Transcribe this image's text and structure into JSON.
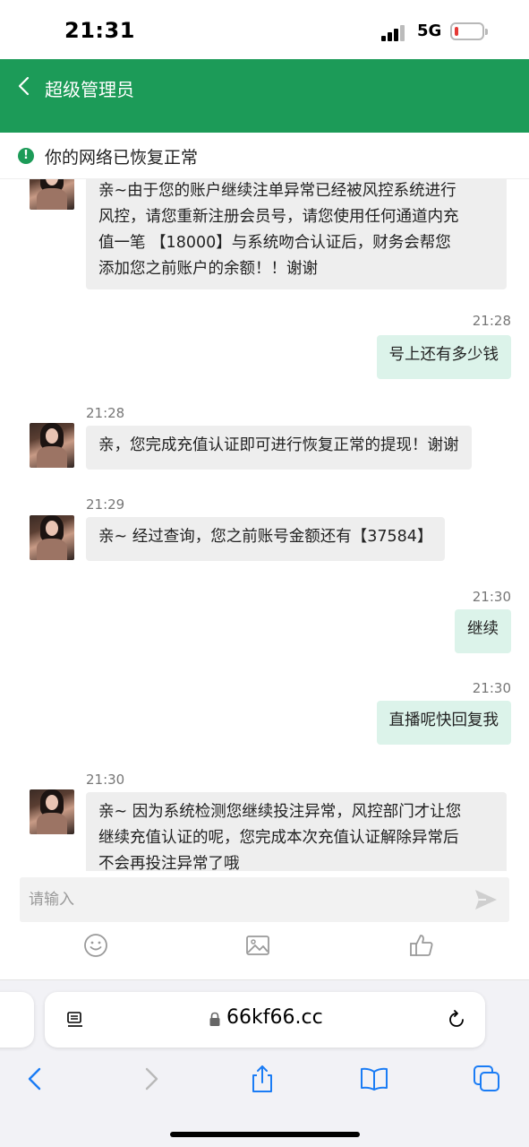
{
  "status_bar": {
    "time": "21:31",
    "network": "5G"
  },
  "header": {
    "title": "超级管理员"
  },
  "network_notice": {
    "text": "你的网络已恢复正常"
  },
  "messages": [
    {
      "dir": "in",
      "time": "",
      "lines": [
        "亲~由于您的账户继续注单异常已经被风控系统进行",
        "风控，请您重新注册会员号，请您使用任何通道内充",
        "值一笔 【18000】与系统吻合认证后，财务会帮您",
        "添加您之前账户的余额！！谢谢"
      ]
    },
    {
      "dir": "out",
      "time": "21:28",
      "lines": [
        "号上还有多少钱"
      ]
    },
    {
      "dir": "in",
      "time": "21:28",
      "lines": [
        "亲，您完成充值认证即可进行恢复正常的提现！谢谢"
      ]
    },
    {
      "dir": "in",
      "time": "21:29",
      "lines": [
        "亲~ 经过查询，您之前账号金额还有【37584】"
      ]
    },
    {
      "dir": "out",
      "time": "21:30",
      "lines": [
        "继续"
      ]
    },
    {
      "dir": "out",
      "time": "21:30",
      "lines": [
        "直播呢快回复我"
      ]
    },
    {
      "dir": "in",
      "time": "21:30",
      "lines": [
        "亲~ 因为系统检测您继续投注异常，风控部门才让您",
        "继续充值认证的呢，您完成本次充值认证解除异常后",
        "不会再投注异常了哦"
      ]
    }
  ],
  "input": {
    "placeholder": "请输入"
  },
  "browser": {
    "url": "66kf66.cc"
  },
  "icons": {
    "send": "send-icon",
    "emoji": "emoji-icon",
    "image": "image-icon",
    "like": "thumbs-up-icon",
    "back": "back-chevron-icon",
    "forward": "forward-chevron-icon",
    "share": "share-icon",
    "bookmarks": "bookmarks-icon",
    "tabs": "tabs-icon",
    "reader": "reader-icon",
    "lock": "lock-icon",
    "reload": "reload-icon"
  },
  "colors": {
    "header": "#1c9b58",
    "incoming_bubble": "#eeeeee",
    "outgoing_bubble": "#dcf3ea",
    "ios_blue": "#1a7cf5"
  }
}
